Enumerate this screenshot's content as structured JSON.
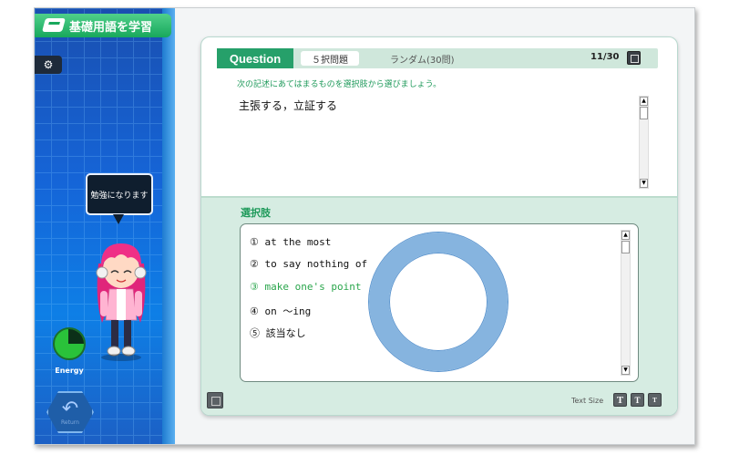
{
  "app": {
    "title": "基礎用語を学習"
  },
  "sidebar": {
    "speech_bubble": "勉強になります",
    "energy_label": "Energy",
    "energy_level": 0.75,
    "return_label": "Return"
  },
  "question": {
    "tag": "Question",
    "type": "５択問題",
    "mode": "ランダム(30問)",
    "counter": "11/30",
    "instruction": "次の記述にあてはまるものを選択肢から選びましょう。",
    "text": "主張する，立証する"
  },
  "choices": {
    "label": "選択肢",
    "items": [
      {
        "mark": "①",
        "text": "at the most",
        "selected": false
      },
      {
        "mark": "②",
        "text": "to say nothing of",
        "selected": false
      },
      {
        "mark": "③",
        "text": "make one's point",
        "selected": true
      },
      {
        "mark": "④",
        "text": "on ～ing",
        "selected": false
      },
      {
        "mark": "⑤",
        "text": "該当なし",
        "selected": false
      }
    ]
  },
  "footer": {
    "text_size_label": "Text Size",
    "text_size_buttons": [
      "T",
      "T",
      "T"
    ]
  },
  "colors": {
    "accent_green": "#26a06a",
    "sidebar_blue": "#1565d8",
    "selected_choice": "#2aa64c",
    "ring_blue": "#86b4df"
  }
}
